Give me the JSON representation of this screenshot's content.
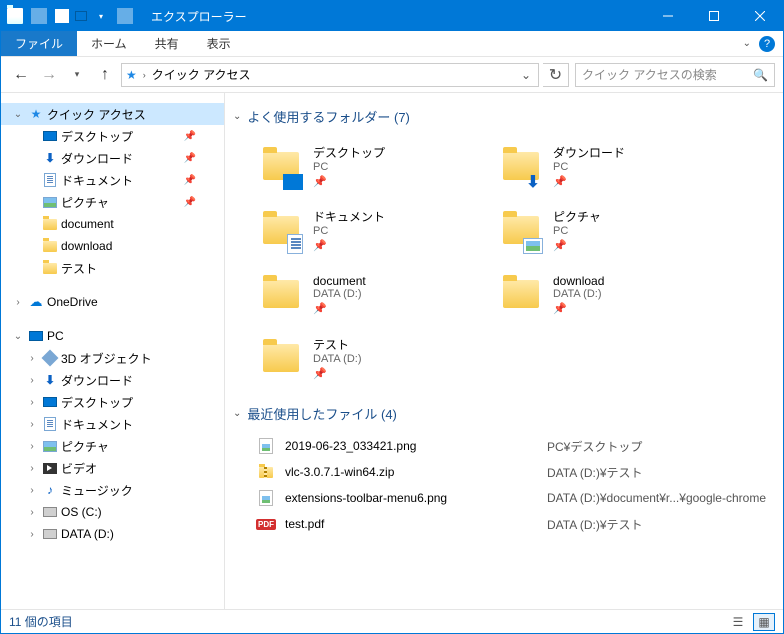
{
  "titlebar": {
    "title": "エクスプローラー"
  },
  "menubar": {
    "file": "ファイル",
    "tabs": [
      "ホーム",
      "共有",
      "表示"
    ]
  },
  "address": {
    "location": "クイック アクセス"
  },
  "search": {
    "placeholder": "クイック アクセスの検索"
  },
  "sidebar": {
    "quick_access": {
      "label": "クイック アクセス",
      "expanded": true,
      "items": [
        {
          "label": "デスクトップ",
          "icon": "desktop",
          "pin": true
        },
        {
          "label": "ダウンロード",
          "icon": "download",
          "pin": true
        },
        {
          "label": "ドキュメント",
          "icon": "document",
          "pin": true
        },
        {
          "label": "ピクチャ",
          "icon": "picture",
          "pin": true
        },
        {
          "label": "document",
          "icon": "folder",
          "pin": false
        },
        {
          "label": "download",
          "icon": "folder",
          "pin": false
        },
        {
          "label": "テスト",
          "icon": "folder",
          "pin": false
        }
      ]
    },
    "onedrive": {
      "label": "OneDrive"
    },
    "pc": {
      "label": "PC",
      "expanded": true,
      "items": [
        {
          "label": "3D オブジェクト",
          "icon": "3d"
        },
        {
          "label": "ダウンロード",
          "icon": "download"
        },
        {
          "label": "デスクトップ",
          "icon": "desktop"
        },
        {
          "label": "ドキュメント",
          "icon": "document"
        },
        {
          "label": "ピクチャ",
          "icon": "picture"
        },
        {
          "label": "ビデオ",
          "icon": "video"
        },
        {
          "label": "ミュージック",
          "icon": "music"
        },
        {
          "label": "OS (C:)",
          "icon": "drive"
        },
        {
          "label": "DATA (D:)",
          "icon": "drive"
        }
      ]
    }
  },
  "sections": {
    "folders": {
      "title": "よく使用するフォルダー (7)",
      "items": [
        {
          "name": "デスクトップ",
          "sub": "PC",
          "icon": "desktop"
        },
        {
          "name": "ダウンロード",
          "sub": "PC",
          "icon": "download"
        },
        {
          "name": "ドキュメント",
          "sub": "PC",
          "icon": "document"
        },
        {
          "name": "ピクチャ",
          "sub": "PC",
          "icon": "picture"
        },
        {
          "name": "document",
          "sub": "DATA (D:)",
          "icon": "folder"
        },
        {
          "name": "download",
          "sub": "DATA (D:)",
          "icon": "folder"
        },
        {
          "name": "テスト",
          "sub": "DATA (D:)",
          "icon": "folder"
        }
      ]
    },
    "recent": {
      "title": "最近使用したファイル (4)",
      "items": [
        {
          "name": "2019-06-23_033421.png",
          "loc": "PC¥デスクトップ",
          "icon": "image"
        },
        {
          "name": "vlc-3.0.7.1-win64.zip",
          "loc": "DATA (D:)¥テスト",
          "icon": "zip"
        },
        {
          "name": "extensions-toolbar-menu6.png",
          "loc": "DATA (D:)¥document¥r...¥google-chrome",
          "icon": "image"
        },
        {
          "name": "test.pdf",
          "loc": "DATA (D:)¥テスト",
          "icon": "pdf"
        }
      ]
    }
  },
  "status": {
    "text": "11 個の項目"
  },
  "pin_glyph": "📌"
}
